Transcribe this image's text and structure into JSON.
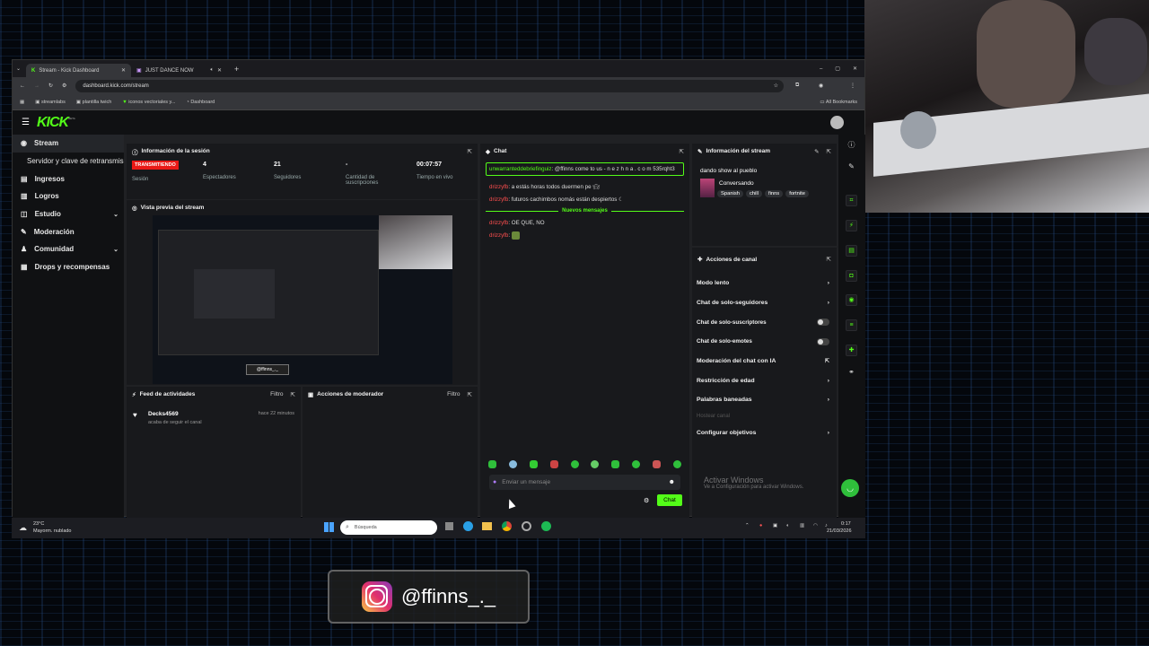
{
  "browser": {
    "tabs": [
      {
        "label": "Stream - Kick Dashboard"
      },
      {
        "label": "JUST DANCE NOW"
      }
    ],
    "url": "dashboard.kick.com/stream",
    "bookmarks": [
      "streamlabs",
      "plantilla twich",
      "iconos vectoriales y...",
      "Dashboard"
    ],
    "all_bookmarks": "All Bookmarks"
  },
  "kick": {
    "logo": "KICK",
    "beta": "BETA",
    "sidebar": [
      {
        "label": "Stream",
        "icon": "broadcast-icon"
      },
      {
        "label": "Servidor y clave de retransmisión",
        "icon": ""
      },
      {
        "label": "Ingresos",
        "icon": "money-icon"
      },
      {
        "label": "Logros",
        "icon": "trophy-icon"
      },
      {
        "label": "Estudio",
        "icon": "studio-icon"
      },
      {
        "label": "Moderación",
        "icon": "hammer-icon"
      },
      {
        "label": "Comunidad",
        "icon": "users-icon"
      },
      {
        "label": "Drops y recompensas",
        "icon": "gift-icon"
      }
    ],
    "session": {
      "title": "Información de la sesión",
      "status": "TRANSMITIENDO",
      "status_label": "Sesión",
      "stats": [
        {
          "value": "4",
          "label": "Espectadores"
        },
        {
          "value": "21",
          "label": "Seguidores"
        },
        {
          "value": "-",
          "label": "Cantidad de suscripciones"
        },
        {
          "value": "00:07:57",
          "label": "Tiempo en vivo"
        }
      ]
    },
    "preview": {
      "title": "Vista previa del stream",
      "overlay_handle": "@ffinns_._"
    },
    "activity": {
      "title": "Feed de actividades",
      "filter": "Filtro",
      "user": "Decks4569",
      "time": "hace 22 minutos",
      "text": "acaba de seguir el canal"
    },
    "modactions": {
      "title": "Acciones de moderador",
      "filter": "Filtro"
    },
    "chat": {
      "title": "Chat",
      "pinned_user": "unwarranteddebriefinguiz",
      "pinned_text": ": @ffinns come to us - n e z h n a . c o m 535rqht3",
      "messages": [
        {
          "user": "drizzyfb",
          "text": ": a estás horas todos duermen pe"
        },
        {
          "user": "drizzyfb",
          "text": ": futuros cachimbos nomás están despiertos"
        }
      ],
      "new_label": "Nuevos mensajes",
      "messages2": [
        {
          "user": "drizzyfb",
          "text": ": OE QUE, NO"
        },
        {
          "user": "drizzyfb",
          "text": ": "
        }
      ],
      "placeholder": "Enviar un mensaje",
      "send": "Chat"
    },
    "streaminfo": {
      "title": "Información del stream",
      "stream_title": "dando show al pueblo",
      "category": "Conversando",
      "tags": [
        "Spanish",
        "chill",
        "finns",
        "fortnite"
      ]
    },
    "channel_actions": {
      "title": "Acciones de canal",
      "items": [
        {
          "label": "Modo lento",
          "type": "chevron"
        },
        {
          "label": "Chat de solo-seguidores",
          "type": "chevron"
        },
        {
          "label": "Chat de solo-suscriptores",
          "type": "toggle"
        },
        {
          "label": "Chat de solo-emotes",
          "type": "toggle"
        },
        {
          "label": "Moderación del chat con IA",
          "type": "external"
        },
        {
          "label": "Restricción de edad",
          "type": "chevron"
        },
        {
          "label": "Palabras baneadas",
          "type": "chevron"
        },
        {
          "label": "Hostear canal",
          "type": "disabled"
        },
        {
          "label": "Configurar objetivos",
          "type": "chevron"
        }
      ]
    },
    "activate": {
      "line1": "Activar Windows",
      "line2": "Ve a Configuración para activar Windows."
    }
  },
  "taskbar": {
    "weather_temp": "23°C",
    "weather_desc": "Mayorm. nublado",
    "search": "Búsqueda",
    "time": "0:17",
    "date": "21/03/2026"
  },
  "instagram": {
    "handle": "@ffinns_._"
  }
}
